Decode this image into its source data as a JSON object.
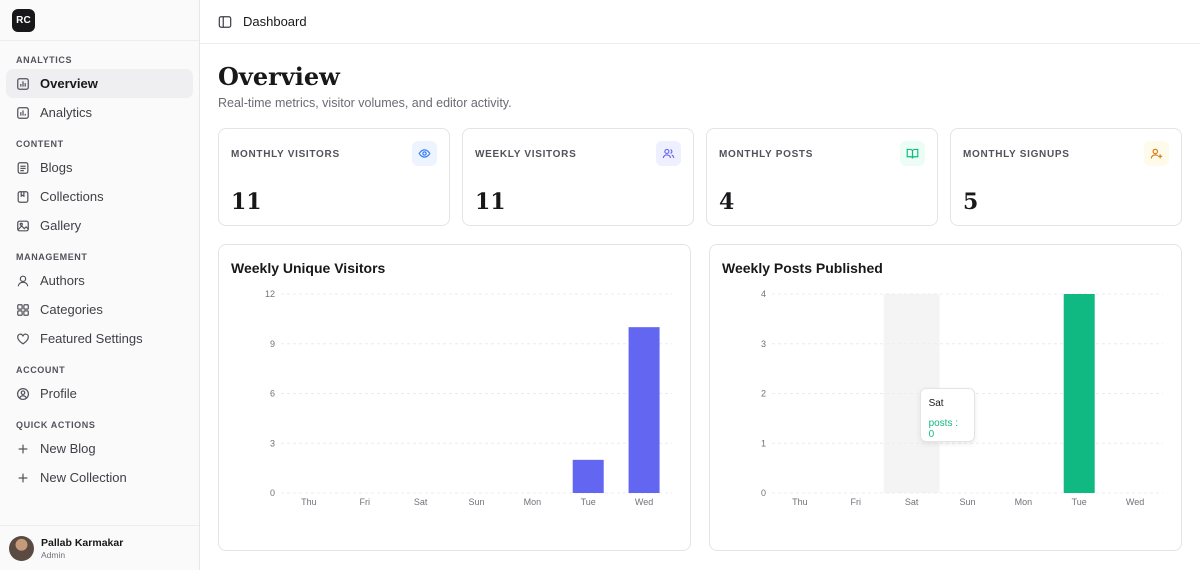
{
  "app": {
    "logo_text": "RC"
  },
  "sidebar": {
    "sections": [
      {
        "title": "ANALYTICS",
        "items": [
          {
            "label": "Overview",
            "icon": "chart-icon",
            "active": true
          },
          {
            "label": "Analytics",
            "icon": "bar-chart-icon"
          }
        ]
      },
      {
        "title": "CONTENT",
        "items": [
          {
            "label": "Blogs",
            "icon": "document-icon"
          },
          {
            "label": "Collections",
            "icon": "collection-icon"
          },
          {
            "label": "Gallery",
            "icon": "image-icon"
          }
        ]
      },
      {
        "title": "MANAGEMENT",
        "items": [
          {
            "label": "Authors",
            "icon": "user-icon"
          },
          {
            "label": "Categories",
            "icon": "grid-icon"
          },
          {
            "label": "Featured Settings",
            "icon": "heart-icon"
          }
        ]
      },
      {
        "title": "ACCOUNT",
        "items": [
          {
            "label": "Profile",
            "icon": "profile-icon"
          }
        ]
      },
      {
        "title": "QUICK ACTIONS",
        "items": [
          {
            "label": "New Blog",
            "icon": "plus-icon"
          },
          {
            "label": "New Collection",
            "icon": "plus-icon"
          }
        ]
      }
    ],
    "user": {
      "name": "Pallab Karmakar",
      "role": "Admin"
    }
  },
  "topbar": {
    "breadcrumb": "Dashboard"
  },
  "page": {
    "title": "Overview",
    "subtitle": "Real-time metrics, visitor volumes, and editor activity."
  },
  "stats": [
    {
      "label": "MONTHLY VISITORS",
      "value": "11",
      "icon": "eye-icon",
      "accent": "#3b82f6",
      "bg": "#eef4ff"
    },
    {
      "label": "WEEKLY VISITORS",
      "value": "11",
      "icon": "users-icon",
      "accent": "#6366f1",
      "bg": "#eef0ff"
    },
    {
      "label": "MONTHLY POSTS",
      "value": "4",
      "icon": "book-icon",
      "accent": "#10b981",
      "bg": "#ecfdf5"
    },
    {
      "label": "MONTHLY SIGNUPS",
      "value": "5",
      "icon": "user-plus-icon",
      "accent": "#d97706",
      "bg": "#fffbeb"
    }
  ],
  "chart_data": [
    {
      "type": "bar",
      "title": "Weekly Unique Visitors",
      "categories": [
        "Thu",
        "Fri",
        "Sat",
        "Sun",
        "Mon",
        "Tue",
        "Wed"
      ],
      "values": [
        0,
        0,
        0,
        0,
        0,
        2,
        10
      ],
      "ylim": [
        0,
        12
      ],
      "yticks": [
        0,
        3,
        6,
        9,
        12
      ],
      "color": "#6366f1",
      "grid": true
    },
    {
      "type": "bar",
      "title": "Weekly Posts Published",
      "categories": [
        "Thu",
        "Fri",
        "Sat",
        "Sun",
        "Mon",
        "Tue",
        "Wed"
      ],
      "values": [
        0,
        0,
        0,
        0,
        0,
        4,
        0
      ],
      "ylim": [
        0,
        4
      ],
      "yticks": [
        0,
        1,
        2,
        3,
        4
      ],
      "color": "#10b981",
      "grid": true,
      "highlight": "Sat",
      "tooltip": {
        "label": "Sat",
        "text": "posts : 0"
      }
    }
  ]
}
